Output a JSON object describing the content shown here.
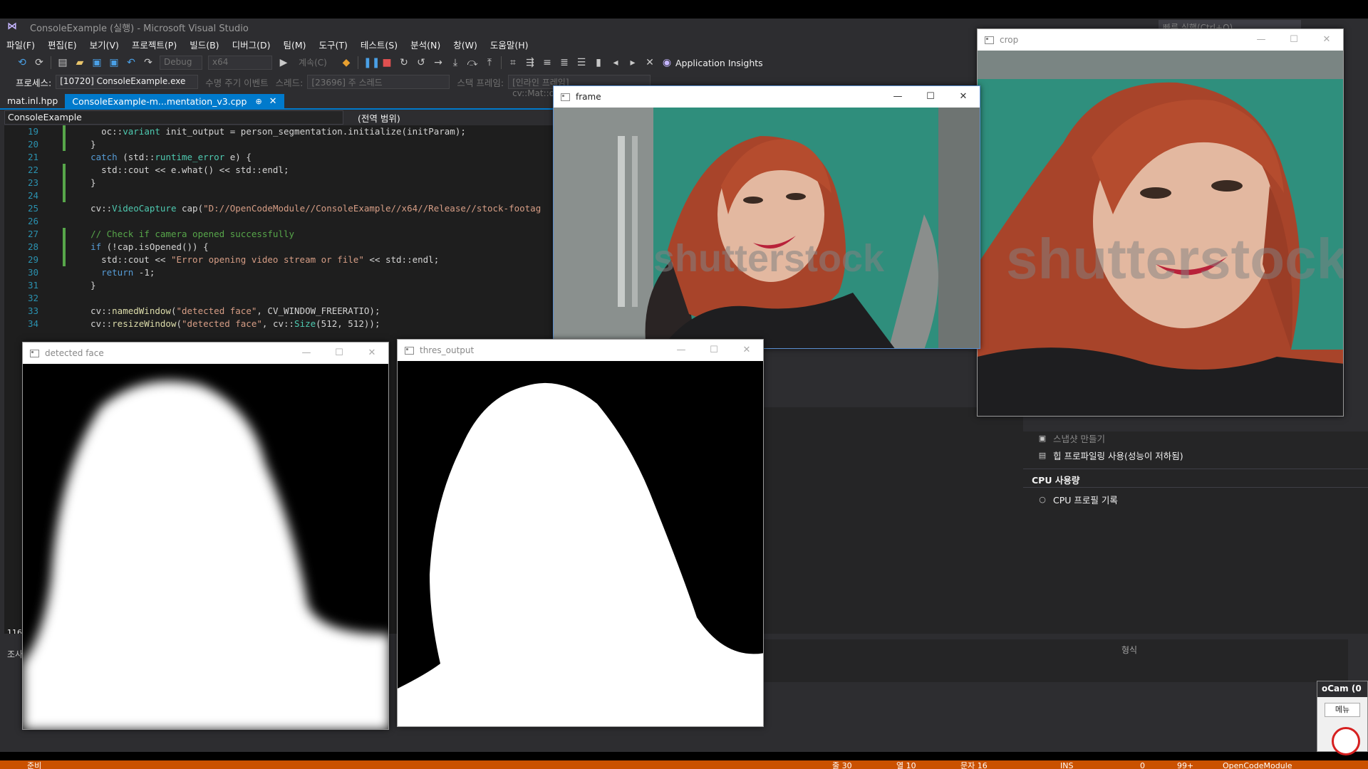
{
  "vs": {
    "title": "ConsoleExample (실행) - Microsoft Visual Studio",
    "quick_launch": "빠른 실행(Ctrl+Q)",
    "menu": [
      "파일(F)",
      "편집(E)",
      "보기(V)",
      "프로젝트(P)",
      "빌드(B)",
      "디버그(D)",
      "팀(M)",
      "도구(T)",
      "테스트(S)",
      "분석(N)",
      "창(W)",
      "도움말(H)"
    ],
    "toolbar": {
      "config": "Debug",
      "platform": "x64",
      "continue": "계속(C)",
      "app_insights": "Application Insights"
    },
    "debugbar": {
      "process_label": "프로세스:",
      "process_value": "[10720] ConsoleExample.exe",
      "lifecycle": "수명 주기 이벤트",
      "thread_label": "스레드:",
      "thread_value": "[23696] 주 스레드",
      "stack_label": "스택 프레임:",
      "stack_value": "[인라인 프레임] cv::Mat::operator()"
    },
    "tabs": [
      {
        "label": "mat.inl.hpp"
      },
      {
        "label": "ConsoleExample-m...mentation_v3.cpp"
      }
    ],
    "nav": {
      "scope": "ConsoleExample",
      "global": "(전역 범위)"
    },
    "code": [
      {
        "n": "19",
        "text": "    oc::variant init_output = person_segmentation.initialize(initParam);"
      },
      {
        "n": "20",
        "text": "  }"
      },
      {
        "n": "21",
        "text": "  catch (std::runtime_error e) {"
      },
      {
        "n": "22",
        "text": "    std::cout << e.what() << std::endl;"
      },
      {
        "n": "23",
        "text": "  }"
      },
      {
        "n": "24",
        "text": ""
      },
      {
        "n": "25",
        "text": "  cv::VideoCapture cap(\"D://OpenCodeModule//ConsoleExample//x64//Release//stock-footag"
      },
      {
        "n": "26",
        "text": ""
      },
      {
        "n": "27",
        "text": "  // Check if camera opened successfully"
      },
      {
        "n": "28",
        "text": "  if (!cap.isOpened()) {"
      },
      {
        "n": "29",
        "text": "    std::cout << \"Error opening video stream or file\" << std::endl;"
      },
      {
        "n": "30",
        "text": "    return -1;"
      },
      {
        "n": "31",
        "text": "  }"
      },
      {
        "n": "32",
        "text": ""
      },
      {
        "n": "33",
        "text": "  cv::namedWindow(\"detected face\", CV_WINDOW_FREERATIO);"
      },
      {
        "n": "34",
        "text": "  cv::resizeWindow(\"detected face\", cv::Size(512, 512));"
      }
    ],
    "zoom": "116",
    "right_panel": {
      "snapshot": "스냅샷 만들기",
      "heap": "힙 프로파일링 사용(성능이 저하됨)",
      "cpu_head": "CPU 사용량",
      "cpu_record": "CPU 프로필 기록"
    },
    "lower": {
      "format_col": "형식",
      "search_label": "조사"
    },
    "status": {
      "ready": "준비",
      "line": "줄 30",
      "col": "열 10",
      "ch": "문자 16",
      "ins": "INS",
      "errors": "0",
      "edits": "99+",
      "repo": "OpenCodeModule"
    }
  },
  "windows": {
    "crop": "crop",
    "frame": "frame",
    "detected": "detected face",
    "thres": "thres_output",
    "watermark": "shutterstock"
  },
  "ocam": {
    "title": "oCam (0",
    "menu": "메뉴"
  }
}
